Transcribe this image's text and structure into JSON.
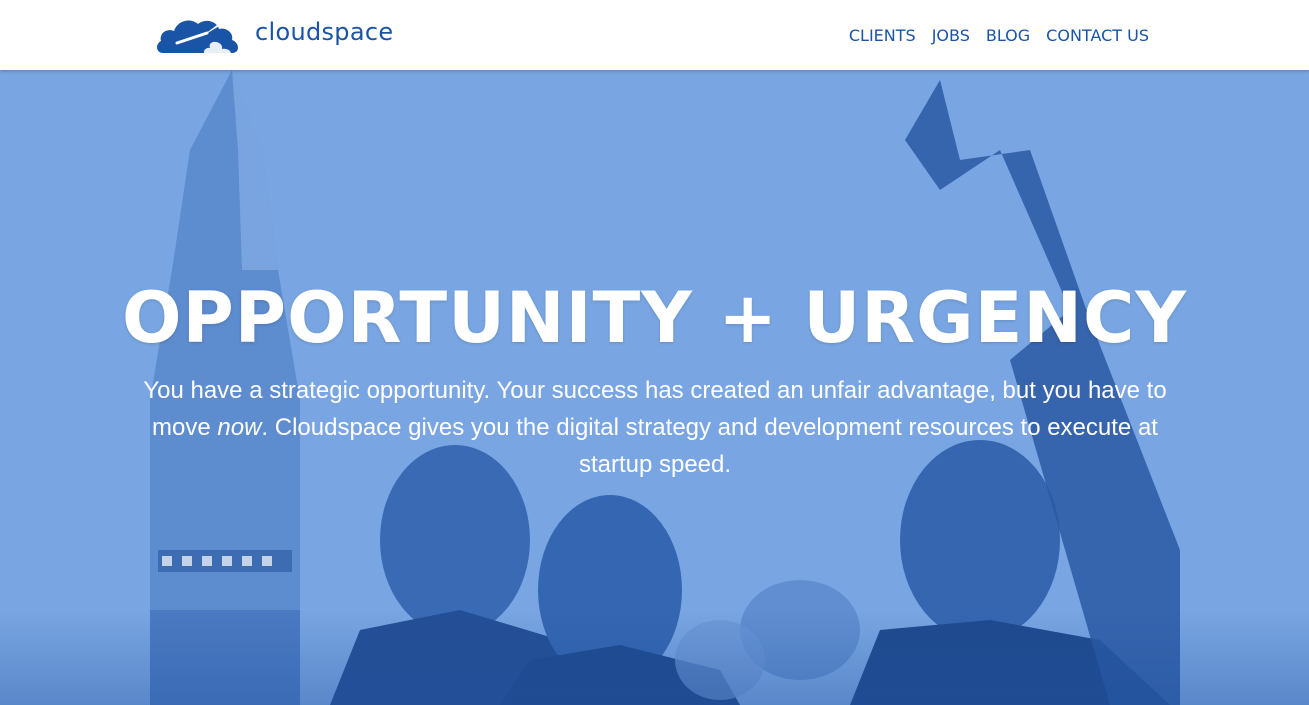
{
  "brand": {
    "name": "cloudspace",
    "logo_icon": "cloud-rocket-icon",
    "color": "#1a54a6"
  },
  "nav": {
    "items": [
      {
        "label": "CLIENTS"
      },
      {
        "label": "JOBS"
      },
      {
        "label": "BLOG"
      },
      {
        "label": "CONTACT US"
      }
    ]
  },
  "hero": {
    "title": "OPPORTUNITY + URGENCY",
    "body_part1": "You have a strategic opportunity. Your success has created an unfair advantage, but you have to move ",
    "body_emphasis": "now",
    "body_part2": ". Cloudspace gives you the digital strategy and development resources to execute at startup speed.",
    "background_color": "#79a6e2",
    "background_image": "rocket-launch-spectators-photo"
  }
}
